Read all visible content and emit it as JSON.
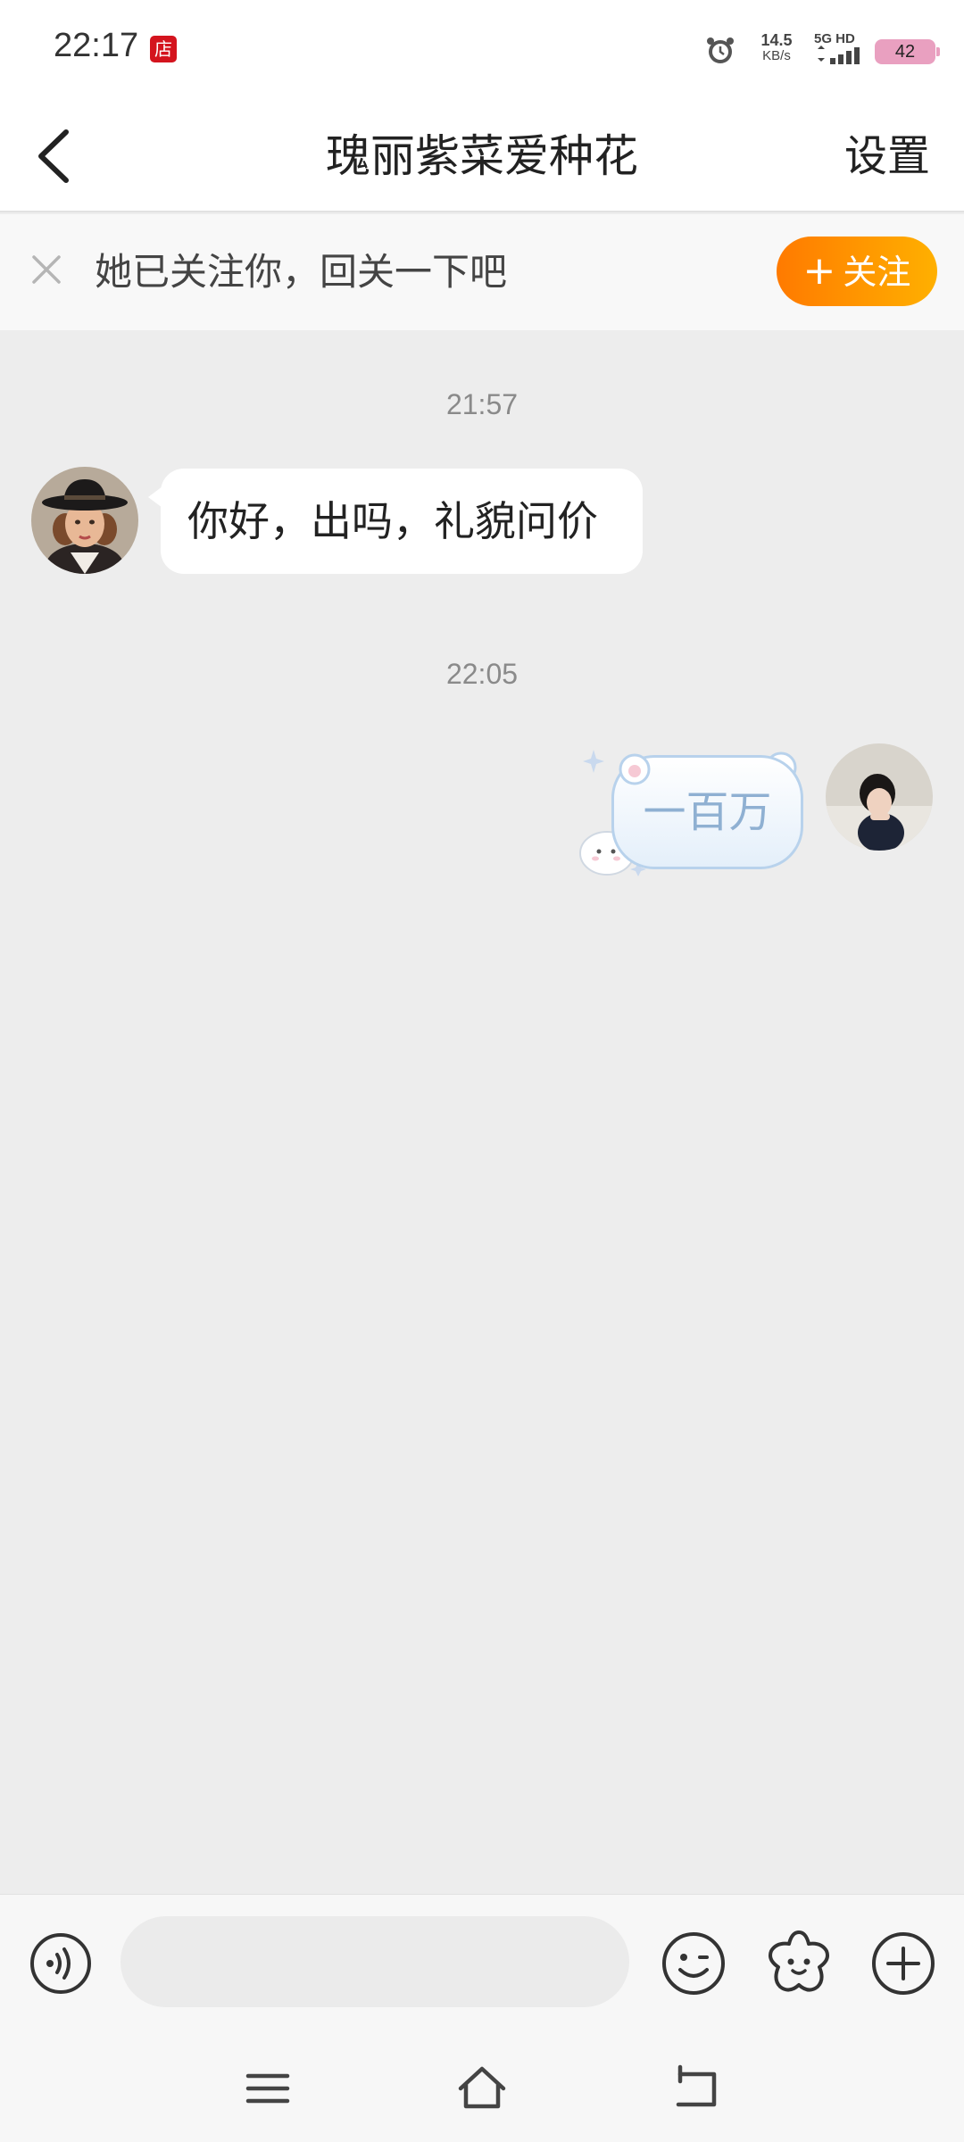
{
  "status_bar": {
    "time": "22:17",
    "store_badge": "店",
    "net_speed_value": "14.5",
    "net_speed_unit": "KB/s",
    "network_label": "5G HD",
    "battery": "42",
    "icons": [
      "alarm-icon",
      "signal-icon",
      "battery-icon"
    ]
  },
  "header": {
    "title": "瑰丽紫菜爱种花",
    "settings_label": "设置",
    "back_icon": "chevron-left-icon"
  },
  "follow_banner": {
    "text": "她已关注你，回关一下吧",
    "button_label": "关注",
    "button_plus": "+",
    "close_icon": "close-icon"
  },
  "messages": [
    {
      "timestamp": "21:57",
      "direction": "in",
      "text": "你好，出吗，礼貌问价"
    },
    {
      "timestamp": "22:05",
      "direction": "out",
      "text": "一百万"
    }
  ],
  "input_bar": {
    "placeholder": "",
    "icons": [
      "voice-icon",
      "emoji-icon",
      "sticker-icon",
      "plus-icon"
    ]
  },
  "system_nav": {
    "icons": [
      "menu-icon",
      "home-icon",
      "back-icon"
    ]
  },
  "colors": {
    "accent_start": "#ff7a00",
    "accent_end": "#ffb000",
    "chat_background": "#ededed",
    "store_badge": "#d4141e"
  }
}
